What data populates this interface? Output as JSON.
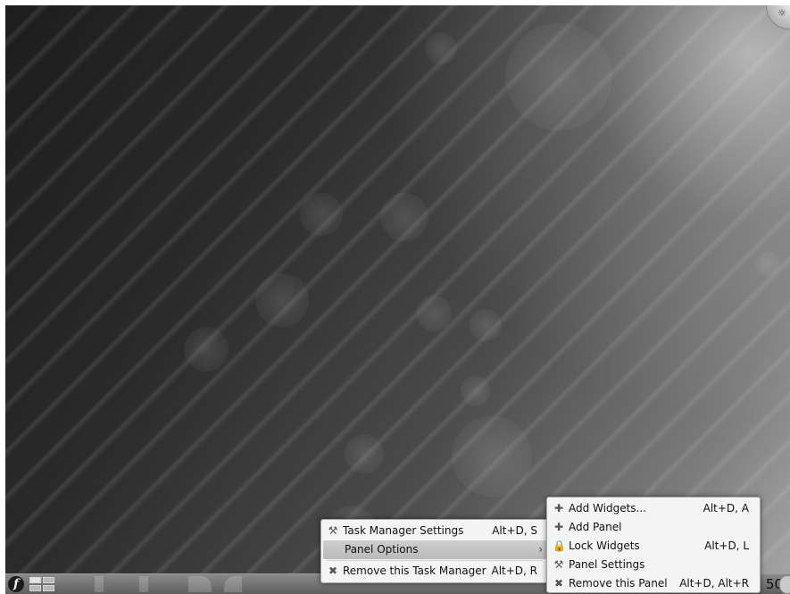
{
  "desktop": {
    "icons": {
      "toolbox": "plasma-toolbox-icon"
    }
  },
  "panel": {
    "launcher_icon": "fedora-launcher-icon",
    "clock_text": "50"
  },
  "task_menu": {
    "items": [
      {
        "icon": "wrench-screwdriver-icon",
        "label": "Task Manager Settings",
        "shortcut": "Alt+D, S"
      },
      {
        "label": "Panel Options",
        "submenu_arrow": "›"
      },
      {
        "icon": "remove-icon",
        "label": "Remove this Task Manager",
        "shortcut": "Alt+D, R"
      }
    ]
  },
  "panel_menu": {
    "items": [
      {
        "icon": "add-icon",
        "label": "Add Widgets...",
        "shortcut": "Alt+D, A"
      },
      {
        "icon": "add-icon",
        "label": "Add Panel",
        "shortcut": ""
      },
      {
        "icon": "lock-icon",
        "label": "Lock Widgets",
        "shortcut": "Alt+D, L"
      },
      {
        "icon": "wrench-screwdriver-icon",
        "label": "Panel Settings",
        "shortcut": ""
      },
      {
        "icon": "remove-icon",
        "label": "Remove this Panel",
        "shortcut": "Alt+D, Alt+R"
      }
    ]
  },
  "colors": {
    "menu_bg": "#f4f4f4",
    "highlight": "#c3c3c3",
    "panel": "#6f6f6f"
  }
}
